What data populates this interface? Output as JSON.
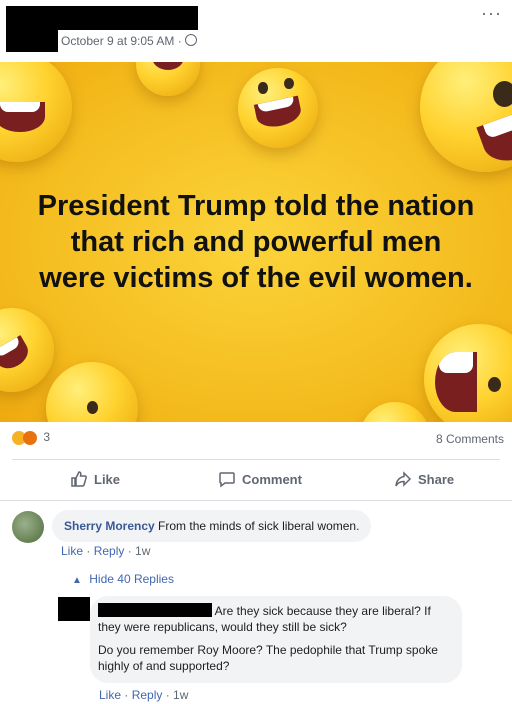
{
  "post": {
    "timestamp": "October 9 at 9:05 AM · ",
    "more_label": "···",
    "image_caption_lines": [
      "President Trump told the nation",
      "that rich and powerful men",
      "were victims of the evil women."
    ],
    "reaction_count": "3",
    "comment_count": "8 Comments"
  },
  "actions": {
    "like": "Like",
    "comment": "Comment",
    "share": "Share"
  },
  "comment1": {
    "author": "Sherry Morency",
    "text": " From the minds of sick liberal women.",
    "like": "Like",
    "reply": "Reply",
    "time": "1w",
    "sep": " · "
  },
  "hide_replies": "Hide 40 Replies",
  "reply1": {
    "text1": "Are they sick because they are liberal? If they were republicans, would they still be sick?",
    "text2": "Do you remember Roy Moore? The pedophile that Trump spoke highly of and supported?",
    "like": "Like",
    "reply": "Reply",
    "time": "1w",
    "sep": " · "
  },
  "colors": {
    "background_yellow": "#f3b81a",
    "link_blue": "#385898",
    "text_gray": "#606770"
  }
}
